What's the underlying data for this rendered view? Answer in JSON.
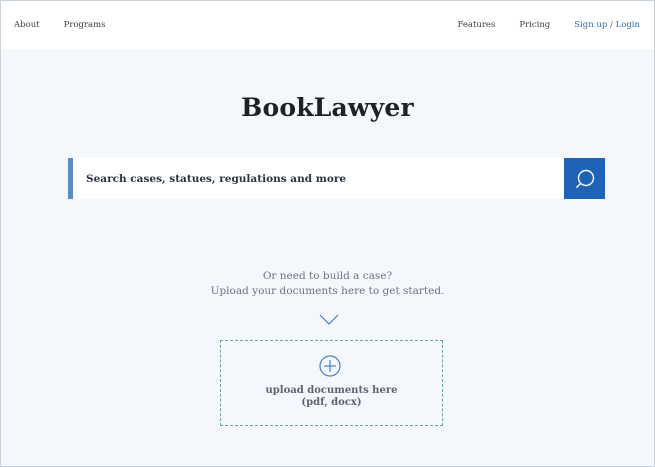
{
  "nav": {
    "left": [
      {
        "label": "About"
      },
      {
        "label": "Programs"
      }
    ],
    "right": [
      {
        "label": "Features"
      },
      {
        "label": "Pricing"
      },
      {
        "label": "Sign up / Login"
      }
    ]
  },
  "brand": {
    "title": "BookLawyer"
  },
  "search": {
    "placeholder": "Search cases, statues, regulations and more",
    "button_icon": "search-icon"
  },
  "upload_prompt": {
    "line1": "Or need to build a case?",
    "line2": "Upload your documents here to get started.",
    "arrow_icon": "chevron-down-icon"
  },
  "dropzone": {
    "icon": "plus-circle-icon",
    "line1": "upload documents here",
    "line2": "(pdf, docx)"
  },
  "colors": {
    "accent": "#1e63b8",
    "link": "#2b6cb0",
    "background": "#f4f7fb"
  }
}
